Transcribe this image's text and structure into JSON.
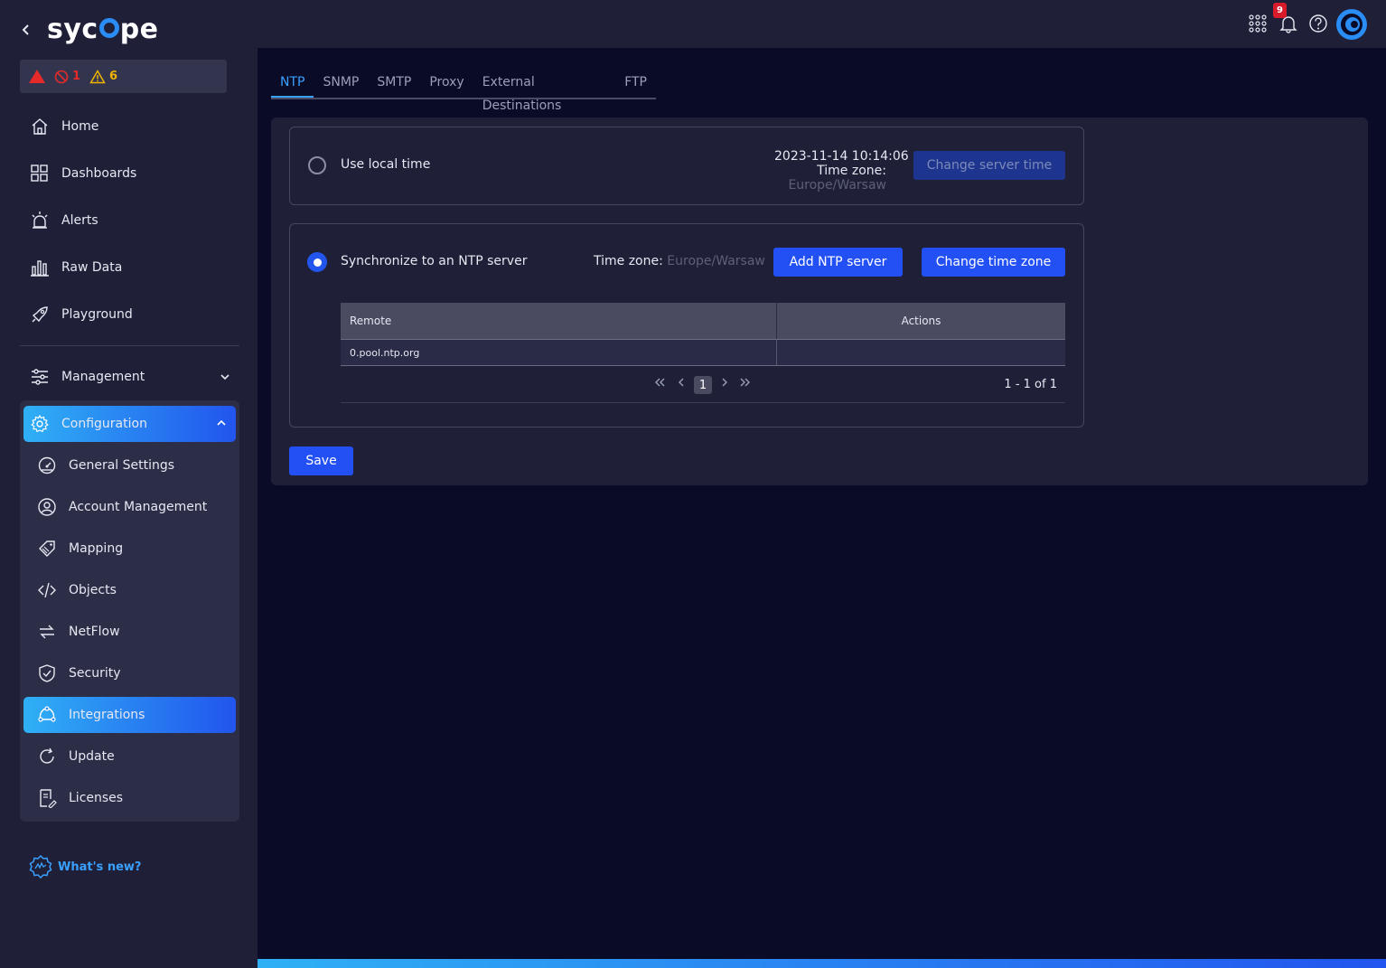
{
  "brand": {
    "logo_left": "syc",
    "logo_right": "pe"
  },
  "alerts": {
    "errors": "1",
    "warnings": "6"
  },
  "nav": {
    "home": "Home",
    "dashboards": "Dashboards",
    "alerts": "Alerts",
    "raw_data": "Raw Data",
    "playground": "Playground",
    "management": "Management",
    "configuration": "Configuration",
    "sub": {
      "general_settings": "General Settings",
      "account_management": "Account Management",
      "mapping": "Mapping",
      "objects": "Objects",
      "netflow": "NetFlow",
      "security": "Security",
      "integrations": "Integrations",
      "update": "Update",
      "licenses": "Licenses"
    },
    "whats_new": "What's new?"
  },
  "topbar": {
    "notification_count": "9"
  },
  "tabs": [
    "NTP",
    "SNMP",
    "SMTP",
    "Proxy",
    "External Destinations",
    "FTP"
  ],
  "local_time": {
    "label": "Use local time",
    "datetime": "2023-11-14 10:14:06",
    "tz_label": "Time zone:",
    "tz_value": "Europe/Warsaw",
    "change_button": "Change server time"
  },
  "ntp": {
    "label": "Synchronize to an NTP server",
    "tz_label": "Time zone:",
    "tz_value": "Europe/Warsaw",
    "add_button": "Add NTP server",
    "change_tz_button": "Change time zone",
    "table": {
      "headers": [
        "Remote",
        "Actions"
      ],
      "rows": [
        {
          "remote": "0.pool.ntp.org",
          "actions": ""
        }
      ]
    },
    "pagination": {
      "current": "1",
      "count_text": "1 - 1 of 1"
    }
  },
  "save_button": "Save",
  "colors": {
    "accent": "#2350f5",
    "active_tab": "#3aa0ff",
    "error": "#e62a2a",
    "warning": "#f0b400"
  }
}
